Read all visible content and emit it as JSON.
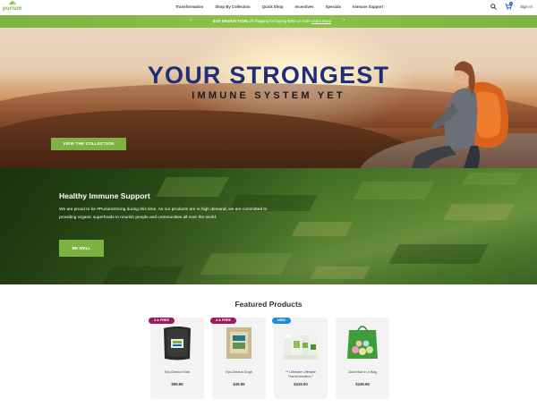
{
  "header": {
    "logo_text": "purium",
    "nav": [
      "Transformation",
      "Shop By Collection",
      "Quick Shop",
      "Incentives",
      "Specials",
      "Immune Support"
    ],
    "sign_in": "Sign In",
    "cart_count": "0"
  },
  "promo": {
    "bold": "$10 DEDUCTION",
    "text": "off shipping for buying $250 or more",
    "link": "Learn More",
    "prev": "‹",
    "next": "›"
  },
  "hero": {
    "title_line1": "YOUR STRONGEST",
    "title_line2": "IMMUNE SYSTEM YET",
    "cta": "VIEW THE COLLECTION"
  },
  "immune_section": {
    "title": "Healthy Immune Support",
    "text": "We are proud to be #PuriumStrong during this time. As our products are in high demand, we are committed to providing organic superfoods to nourish people and communities all over the world.",
    "cta": "BE WELL"
  },
  "featured": {
    "title": "Featured Products",
    "products": [
      {
        "badge": "3 & FREE",
        "badge_type": "free",
        "name": "Epi-Genius Kids",
        "price": "$99.95",
        "color": "#2a2a2a"
      },
      {
        "badge": "3 & FREE",
        "badge_type": "free",
        "name": "Epi-Genius Dogs",
        "price": "$49.95",
        "color": "#c9b98f"
      },
      {
        "badge": "NEW",
        "badge_type": "new",
        "name": "** Ultimate Lifestyle Transformation *",
        "price": "$419.00",
        "color": "#8fbf5a"
      },
      {
        "badge": "",
        "badge_type": "none",
        "name": "Juice Bar in a Bag",
        "price": "$249.95",
        "color": "#3f9c3a"
      }
    ]
  },
  "colors": {
    "accent_green": "#7cb342",
    "hero_title_blue": "#1f2e78",
    "badge_free": "#a0175a",
    "badge_new": "#1a8fd6"
  }
}
